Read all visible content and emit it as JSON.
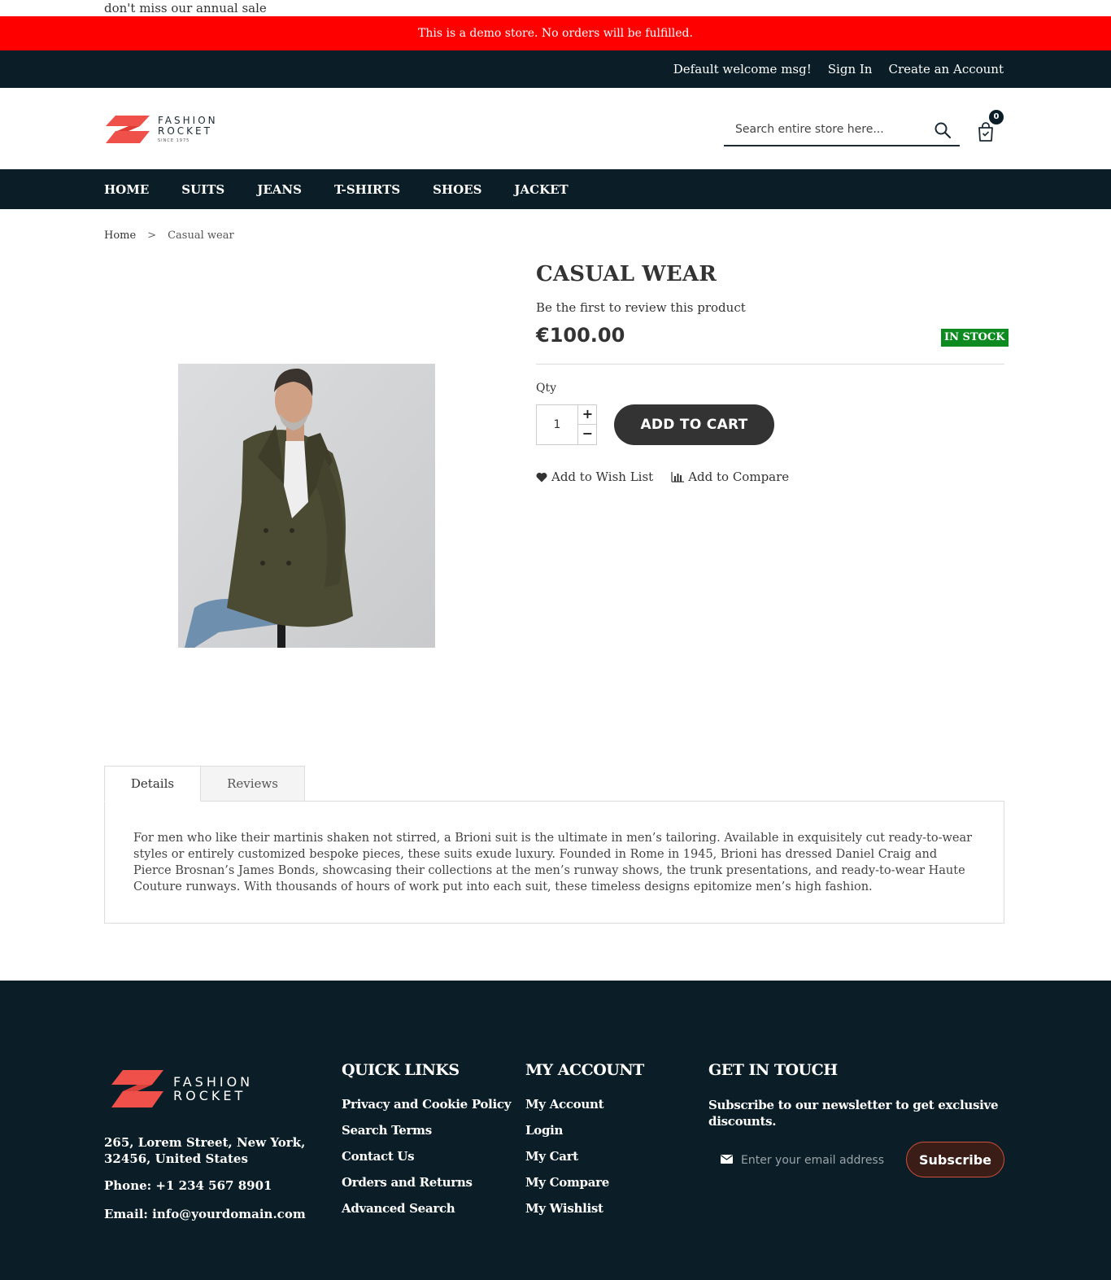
{
  "sale_line": "don't miss our annual sale",
  "demo_notice": "This is a demo store. No orders will be fulfilled.",
  "top_bar": {
    "welcome": "Default welcome msg!",
    "sign_in": "Sign In",
    "create_account": "Create an Account"
  },
  "header": {
    "logo": {
      "line1": "FASHION",
      "line2": "ROCKET",
      "line3": "SINCE 1975"
    },
    "search_placeholder": "Search entire store here...",
    "cart_count": "0"
  },
  "nav": [
    "HOME",
    "SUITS",
    "JEANS",
    "T-SHIRTS",
    "SHOES",
    "JACKET"
  ],
  "breadcrumb": {
    "home": "Home",
    "separator": ">",
    "current": "Casual wear"
  },
  "product": {
    "title": "CASUAL WEAR",
    "review_prompt": "Be the first to review this product",
    "price": "€100.00",
    "stock": "IN STOCK",
    "qty_label": "Qty",
    "qty_value": "1",
    "qty_plus": "+",
    "qty_minus": "−",
    "add_to_cart": "ADD TO CART",
    "wishlist": "Add to Wish List",
    "compare": "Add to Compare"
  },
  "tabs": {
    "details_label": "Details",
    "reviews_label": "Reviews",
    "details_text": "For men who like their martinis shaken not stirred, a Brioni suit is the ultimate in men’s tailoring. Available in exquisitely cut ready-to-wear styles or entirely customized bespoke pieces, these suits exude luxury. Founded in Rome in 1945, Brioni has dressed Daniel Craig and Pierce Brosnan’s James Bonds, showcasing their collections at the men’s runway shows, the trunk presentations, and ready-to-wear Haute Couture runways. With thousands of hours of work put into each suit, these timeless designs epitomize men’s high fashion."
  },
  "footer": {
    "logo": {
      "line1": "FASHION",
      "line2": "ROCKET"
    },
    "address": "265, Lorem Street, New York, 32456, United States",
    "phone": "Phone: +1 234 567 8901",
    "email": "Email: info@yourdomain.com",
    "quick_links": {
      "title": "QUICK LINKS",
      "items": [
        "Privacy and Cookie Policy",
        "Search Terms",
        "Contact Us",
        "Orders and Returns",
        "Advanced Search"
      ]
    },
    "my_account": {
      "title": "MY ACCOUNT",
      "items": [
        "My Account",
        "Login",
        "My Cart",
        "My Compare",
        "My Wishlist"
      ]
    },
    "get_in_touch": {
      "title": "GET IN TOUCH",
      "text": "Subscribe to our newsletter to get exclusive discounts.",
      "email_placeholder": "Enter your email address",
      "subscribe": "Subscribe"
    }
  },
  "colors": {
    "dark_navy": "#0b1e27",
    "demo_red": "#ff0000",
    "stock_green": "#0d8a20",
    "logo_coral": "#f0504a"
  }
}
